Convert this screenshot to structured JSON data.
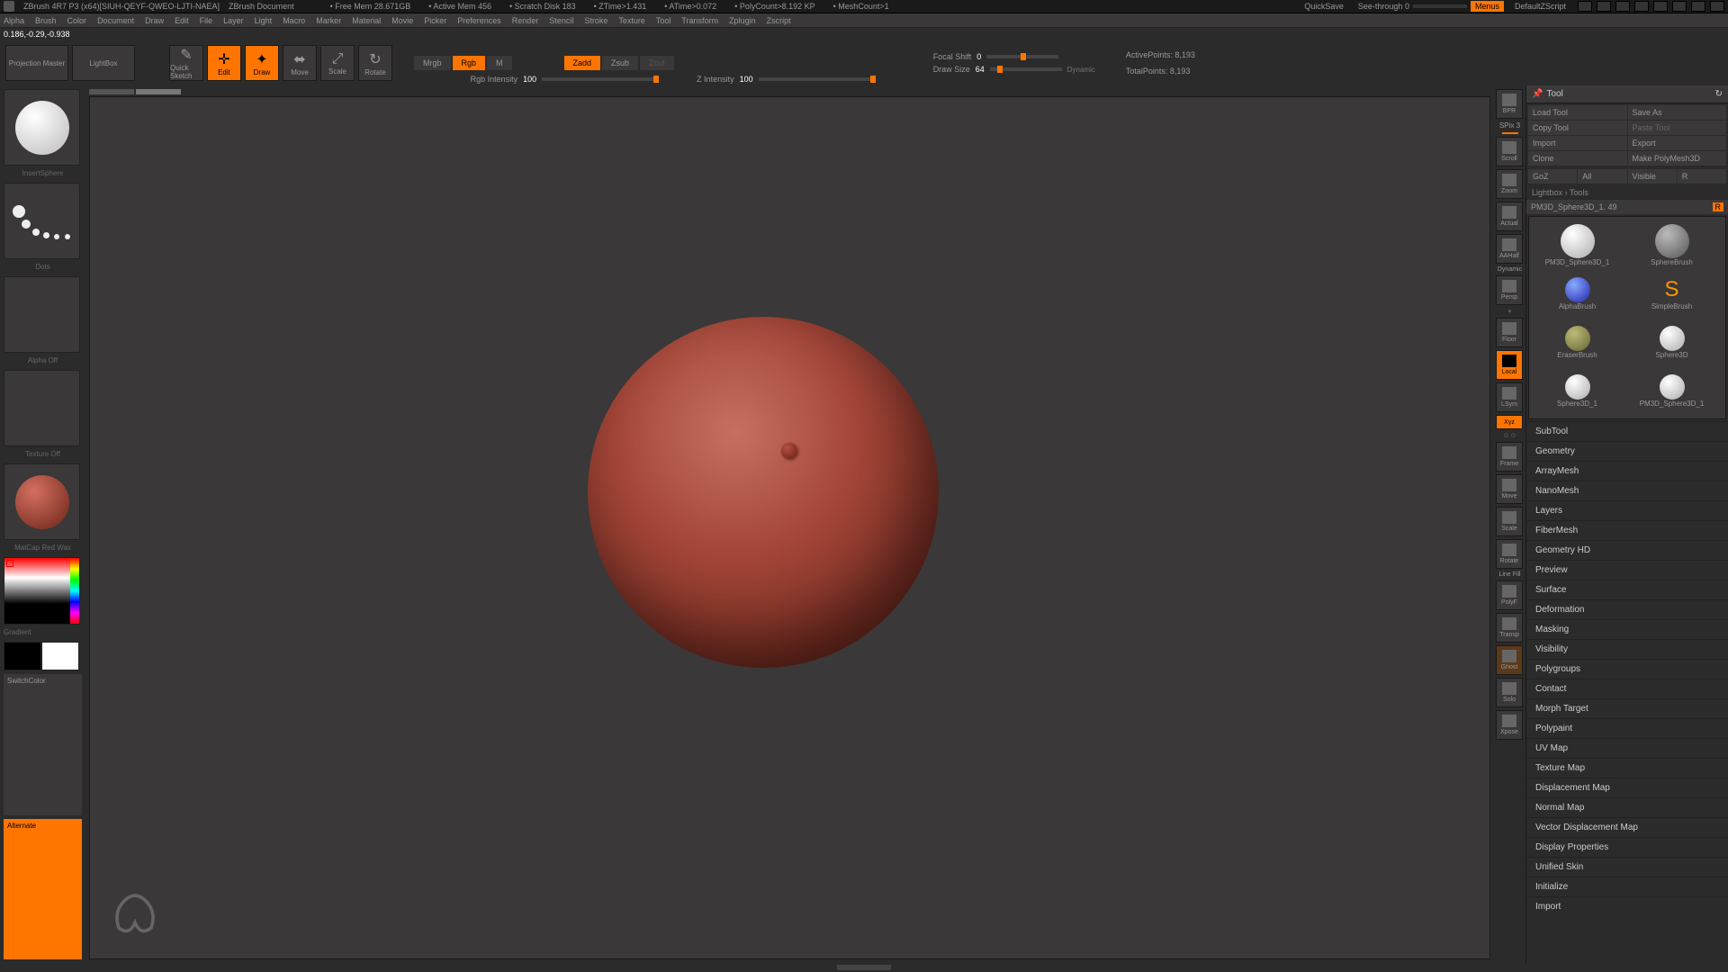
{
  "titlebar": {
    "app": "ZBrush 4R7 P3 (x64)[SIUH-QEYF-QWEO-LJTI-NAEA]",
    "doc": "ZBrush Document",
    "stats": [
      "Free Mem 28.671GB",
      "Active Mem 456",
      "Scratch Disk 183",
      "ZTime>1.431",
      "ATime>0.072",
      "PolyCount>8.192 KP",
      "MeshCount>1"
    ],
    "quicksave": "QuickSave",
    "seethrough": "See-through  0",
    "menus": "Menus",
    "script": "DefaultZScript"
  },
  "menubar": [
    "Alpha",
    "Brush",
    "Color",
    "Document",
    "Draw",
    "Edit",
    "File",
    "Layer",
    "Light",
    "Macro",
    "Marker",
    "Material",
    "Movie",
    "Picker",
    "Preferences",
    "Render",
    "Stencil",
    "Stroke",
    "Texture",
    "Tool",
    "Transform",
    "Zplugin",
    "Zscript"
  ],
  "coords": "0.186,-0.29,-0.938",
  "toptools": {
    "projection": "Projection Master",
    "lightbox": "LightBox",
    "quicksketch": "Quick Sketch",
    "edit": "Edit",
    "draw": "Draw",
    "move": "Move",
    "scale": "Scale",
    "rotate": "Rotate"
  },
  "modes": {
    "mrgb": "Mrgb",
    "rgb": "Rgb",
    "m": "M",
    "zadd": "Zadd",
    "zsub": "Zsub",
    "zcut": "Zcut"
  },
  "sliders": {
    "rgb_label": "Rgb Intensity",
    "rgb_val": "100",
    "z_label": "Z Intensity",
    "z_val": "100",
    "focal_label": "Focal Shift",
    "focal_val": "0",
    "draw_label": "Draw Size",
    "draw_val": "64",
    "dynamic": "Dynamic"
  },
  "stats": {
    "active": "ActivePoints: 8,193",
    "total": "TotalPoints: 8,193"
  },
  "left": {
    "insert_label": "InsertSphere",
    "stroke_label": "Dots",
    "alpha_label": "Alpha Off",
    "texture_label": "Texture Off",
    "material_label": "MatCap Red Wax",
    "gradient": "Gradient",
    "switch": "SwitchColor",
    "alternate": "Alternate"
  },
  "shelf": {
    "bpr": "BPR",
    "spix": "SPix 3",
    "scroll": "Scroll",
    "zoom": "Zoom",
    "actual": "Actual",
    "aahalf": "AAHalf",
    "dynamic": "Dynamic",
    "persp": "Persp",
    "floor": "Floor",
    "local": "Local",
    "lsym": "LSym",
    "xyz": "Xyz",
    "frame": "Frame",
    "move": "Move",
    "scale": "Scale",
    "rotate": "Rotate",
    "linefill": "Line Fill",
    "polyf": "PolyF",
    "transp": "Transp",
    "ghost": "Ghost",
    "solo": "Solo",
    "xpose": "Xpose"
  },
  "right": {
    "title": "Tool",
    "load": "Load Tool",
    "save": "Save As",
    "copy": "Copy Tool",
    "paste": "Paste Tool",
    "import": "Import",
    "export": "Export",
    "clone": "Clone",
    "makepoly": "Make PolyMesh3D",
    "goz": "GoZ",
    "all": "All",
    "visible": "Visible",
    "r": "R",
    "lightbox_tools": "Lightbox › Tools",
    "current_tool": "PM3D_Sphere3D_1. 49",
    "tools": [
      "PM3D_Sphere3D_1",
      "SphereBrush",
      "AlphaBrush",
      "SimpleBrush",
      "EraserBrush",
      "Sphere3D",
      "Sphere3D_1",
      "PM3D_Sphere3D_1"
    ],
    "sections": [
      "SubTool",
      "Geometry",
      "ArrayMesh",
      "NanoMesh",
      "Layers",
      "FiberMesh",
      "Geometry HD",
      "Preview",
      "Surface",
      "Deformation",
      "Masking",
      "Visibility",
      "Polygroups",
      "Contact",
      "Morph Target",
      "Polypaint",
      "UV Map",
      "Texture Map",
      "Displacement Map",
      "Normal Map",
      "Vector Displacement Map",
      "Display Properties",
      "Unified Skin",
      "Initialize",
      "Import"
    ]
  }
}
